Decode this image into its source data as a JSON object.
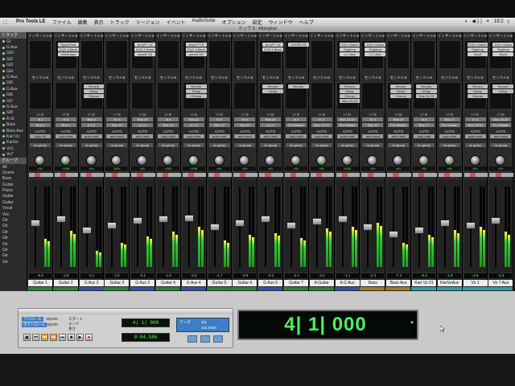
{
  "menubar": {
    "app": "Pro Tools LE",
    "items": [
      "ファイル",
      "編集",
      "表示",
      "トラック",
      "リージョン",
      "イベント",
      "AudioSuite",
      "オプション",
      "設定",
      "ウィンドウ",
      "ヘルプ"
    ],
    "clock": "19:2"
  },
  "window": {
    "title": "ミックス: Afterglow"
  },
  "left_panel": {
    "tracks_header": "トラック",
    "tracks": [
      "Gt",
      "G Aux",
      "GIN",
      "Gt2",
      "Gt3",
      "Gt4",
      "G Aux",
      "Gt5",
      "G Aux",
      "Gt6",
      "Gt7",
      "G Aux",
      "Gt8",
      "A Gt",
      "Bass",
      "Bass Aux",
      "Kari Vo",
      "KariVo",
      "Vo1",
      "Vo7"
    ],
    "groups_header": "グループ",
    "groups": [
      "All",
      "Drums",
      "Bass",
      "Guitar",
      "Piano",
      "Guitar",
      "Guitar",
      "Vocal",
      "Voc",
      "Gtr",
      "Gtr",
      "Gtr",
      "Gtr",
      "Gtr",
      "Gtr",
      "Gtr",
      "Gtr"
    ]
  },
  "labels": {
    "inserts": "インサートA-E",
    "sends": "センドA-E",
    "io": "I / O",
    "auto": "AUTO",
    "group": "no group",
    "pan_prefix": "pan"
  },
  "strips": [
    {
      "name": "Guitar 1",
      "inserts": [
        "",
        "",
        ""
      ],
      "sends": [],
      "input": "In 1",
      "output": "Bus 3",
      "auto": "auto off",
      "pan": ">0<",
      "vol": "-6.8",
      "meter": 0.35,
      "fader": 0.55,
      "color": "#2a7f3a"
    },
    {
      "name": "Guitar 2",
      "inserts": [
        "SpaceFirst",
        "EQ3 4-Band",
        "Generique"
      ],
      "sends": [],
      "input": "In 2",
      "output": "Bus 4",
      "auto": "auto read",
      "pan": "<100",
      "vol": "-2.8",
      "meter": 0.45,
      "fader": 0.6,
      "color": "#2a7f3a"
    },
    {
      "name": "G Aux 2",
      "inserts": [
        "",
        "",
        ""
      ],
      "sends": [
        "Reverb",
        "Delay",
        "Chorus"
      ],
      "input": "Bus 3",
      "output": "A 1-2",
      "auto": "auto read",
      "pan": ">0<",
      "vol": "-0.1",
      "meter": 0.2,
      "fader": 0.45,
      "color": "#3a4fa0"
    },
    {
      "name": "Guitar 3",
      "inserts": [
        "",
        "",
        ""
      ],
      "sends": [],
      "input": "In 3",
      "output": "Bus 10",
      "auto": "auto read",
      "pan": "100>",
      "vol": "0.0",
      "meter": 0.3,
      "fader": 0.52,
      "color": "#2a7f3a"
    },
    {
      "name": "G Aux 3",
      "inserts": [
        "AmpFT LE",
        "EQ3 4-Band",
        "panoff 2/6"
      ],
      "sends": [],
      "input": "Bus 10",
      "output": "A 1-2",
      "auto": "auto read",
      "pan": ">0<",
      "vol": "-0.1",
      "meter": 0.38,
      "fader": 0.58,
      "color": "#3a4fa0"
    },
    {
      "name": "Guitar 4",
      "inserts": [
        "",
        "",
        ""
      ],
      "sends": [],
      "input": "In 4",
      "output": "Bus 21",
      "auto": "auto read",
      "pan": "<100",
      "vol": "-1.6",
      "meter": 0.44,
      "fader": 0.6,
      "color": "#2a7f3a"
    },
    {
      "name": "G Aux 4",
      "inserts": [
        "AmpFT LE",
        "EQ3 4-Band",
        "panoff 2/6"
      ],
      "sends": [
        "Reverb",
        "Delay",
        "Chorus"
      ],
      "input": "Bus 21",
      "output": "A 1-2",
      "auto": "auto read",
      "pan": "<100",
      "vol": "-0.8",
      "meter": 0.5,
      "fader": 0.62,
      "color": "#3a4fa0"
    },
    {
      "name": "Guitar 5",
      "inserts": [
        "",
        "",
        ""
      ],
      "sends": [],
      "input": "In 5",
      "output": "Bus 22",
      "auto": "auto read",
      "pan": ">0<",
      "vol": "-4.7",
      "meter": 0.33,
      "fader": 0.5,
      "color": "#2a7f3a"
    },
    {
      "name": "Guitar 6",
      "inserts": [
        "",
        "",
        ""
      ],
      "sends": [],
      "input": "In 6",
      "output": "Bus 23",
      "auto": "auto read",
      "pan": ">0<",
      "vol": "-3.9",
      "meter": 0.4,
      "fader": 0.55,
      "color": "#2a7f3a"
    },
    {
      "name": "G Aux 6",
      "inserts": [
        "AmpFT LE",
        "EQ3 4-Band",
        ""
      ],
      "sends": [
        "Reverb",
        "Delay"
      ],
      "input": "Bus 23",
      "output": "A 1-2",
      "auto": "auto read",
      "pan": ">0<",
      "vol": "-0.5",
      "meter": 0.42,
      "fader": 0.6,
      "color": "#3a4fa0"
    },
    {
      "name": "Guitar 7",
      "inserts": [
        "JOOEEXN",
        ""
      ],
      "sends": [
        "Reverb"
      ],
      "input": "In 2",
      "output": "Pro Master",
      "auto": "auto read",
      "pan": ">0<",
      "vol": "-2.4",
      "meter": 0.36,
      "fader": 0.52,
      "color": "#2a7f3a"
    },
    {
      "name": "A Guitar",
      "inserts": [
        "",
        "",
        ""
      ],
      "sends": [],
      "input": "In 1",
      "output": "Bus 13-14",
      "auto": "auto read",
      "pan": ">0<",
      "vol": "-3.2",
      "meter": 0.48,
      "fader": 0.57,
      "color": "#2a7f3a"
    },
    {
      "name": "A G Aux",
      "inserts": [
        "EQ3 4-Band",
        "DigiAmp",
        "L1 Ultra"
      ],
      "sends": [
        "Reverb",
        "Delay",
        "Chorus",
        "Bus 13-19"
      ],
      "input": "Bus 13-14",
      "output": "Pro Master",
      "auto": "auto read",
      "pan": "<100",
      "vol": "-1.1",
      "meter": 0.5,
      "fader": 0.6,
      "color": "#3a4fa0"
    },
    {
      "name": "Bass",
      "inserts": [
        "EQ3 4-Band",
        "DigiAmp",
        "L1 Ultra"
      ],
      "sends": [],
      "input": "In 3",
      "output": "Bus 15",
      "auto": "auto read",
      "pan": ">0<",
      "vol": "-2.2",
      "meter": 0.55,
      "fader": 0.5,
      "color": "#a07a2a"
    },
    {
      "name": "Bass Aux",
      "inserts": [
        "",
        "",
        ""
      ],
      "sends": [
        "Reverb",
        "Delay",
        "Chorus"
      ],
      "input": "Bus 15",
      "output": "Pro Master",
      "auto": "auto read",
      "pan": ">0<",
      "vol": "-7.4",
      "meter": 0.3,
      "fader": 0.4,
      "color": "#a07a2a"
    },
    {
      "name": "Kari Vo 01",
      "inserts": [
        "",
        "",
        ""
      ],
      "sends": [
        "Reverb",
        "Delay",
        "Bus 15-20"
      ],
      "input": "In 4",
      "output": "Bus 17",
      "auto": "auto read",
      "pan": ">0<",
      "vol": "-6.3",
      "meter": 0.4,
      "fader": 0.45,
      "color": "#2aa0a0"
    },
    {
      "name": "KariVoAux",
      "inserts": [
        "",
        "",
        ""
      ],
      "sends": [],
      "input": "Bus 17",
      "output": "Pro Master",
      "auto": "auto read",
      "pan": ">0<",
      "vol": "-1.8",
      "meter": 0.46,
      "fader": 0.55,
      "color": "#2aa0a0"
    },
    {
      "name": "Vo 1",
      "inserts": [
        "EQ3 4-Band",
        "DigiAmp",
        "Dyn3"
      ],
      "sends": [
        "Reverb",
        "Delay",
        "Chorus"
      ],
      "input": "In 4",
      "output": "Bus 19-20",
      "auto": "auto read",
      "pan": ">0<",
      "vol": "-4.5",
      "meter": 0.5,
      "fader": 0.52,
      "color": "#2aa0a0"
    },
    {
      "name": "Vo 7 Aux",
      "inserts": [
        "EQ3 4-Band",
        "DigiAmp",
        "Dyn3"
      ],
      "sends": [
        "Reverb",
        "Delay"
      ],
      "input": "Bus 19-20",
      "output": "Pro Master",
      "auto": "auto read",
      "pan": ">0<",
      "vol": "-3.3",
      "meter": 0.44,
      "fader": 0.58,
      "color": "#2aa0a0"
    }
  ],
  "transport": {
    "pre_label": "プリロール",
    "post_label": "ポストロール",
    "pre_value": "0|0|000",
    "post_value": "0|0|000",
    "start_label": "スタート",
    "end_label": "エンド",
    "length_label": "長さ",
    "main_counter": "4| 1| 000",
    "sub_counter": "0:04.586",
    "tempo_label": "テンポ",
    "tempo_value": "151.0000",
    "meter_value": "4/4",
    "buttons": [
      "online",
      "rtz",
      "rewind",
      "forward",
      "end",
      "stop",
      "play",
      "record"
    ]
  },
  "big_counter": {
    "value": "4| 1| 000"
  }
}
